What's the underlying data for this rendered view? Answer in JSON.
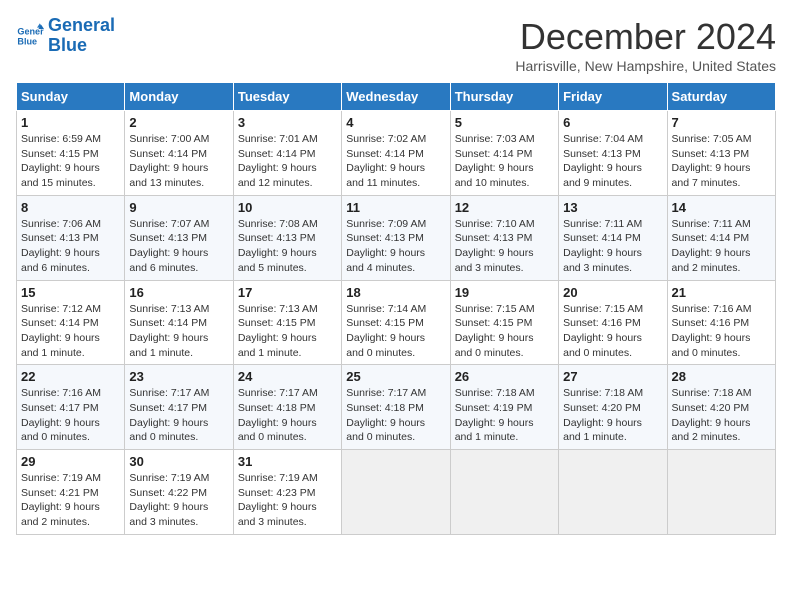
{
  "logo": {
    "line1": "General",
    "line2": "Blue"
  },
  "title": "December 2024",
  "subtitle": "Harrisville, New Hampshire, United States",
  "days_of_week": [
    "Sunday",
    "Monday",
    "Tuesday",
    "Wednesday",
    "Thursday",
    "Friday",
    "Saturday"
  ],
  "weeks": [
    [
      {
        "day": 1,
        "info": "Sunrise: 6:59 AM\nSunset: 4:15 PM\nDaylight: 9 hours\nand 15 minutes."
      },
      {
        "day": 2,
        "info": "Sunrise: 7:00 AM\nSunset: 4:14 PM\nDaylight: 9 hours\nand 13 minutes."
      },
      {
        "day": 3,
        "info": "Sunrise: 7:01 AM\nSunset: 4:14 PM\nDaylight: 9 hours\nand 12 minutes."
      },
      {
        "day": 4,
        "info": "Sunrise: 7:02 AM\nSunset: 4:14 PM\nDaylight: 9 hours\nand 11 minutes."
      },
      {
        "day": 5,
        "info": "Sunrise: 7:03 AM\nSunset: 4:14 PM\nDaylight: 9 hours\nand 10 minutes."
      },
      {
        "day": 6,
        "info": "Sunrise: 7:04 AM\nSunset: 4:13 PM\nDaylight: 9 hours\nand 9 minutes."
      },
      {
        "day": 7,
        "info": "Sunrise: 7:05 AM\nSunset: 4:13 PM\nDaylight: 9 hours\nand 7 minutes."
      }
    ],
    [
      {
        "day": 8,
        "info": "Sunrise: 7:06 AM\nSunset: 4:13 PM\nDaylight: 9 hours\nand 6 minutes."
      },
      {
        "day": 9,
        "info": "Sunrise: 7:07 AM\nSunset: 4:13 PM\nDaylight: 9 hours\nand 6 minutes."
      },
      {
        "day": 10,
        "info": "Sunrise: 7:08 AM\nSunset: 4:13 PM\nDaylight: 9 hours\nand 5 minutes."
      },
      {
        "day": 11,
        "info": "Sunrise: 7:09 AM\nSunset: 4:13 PM\nDaylight: 9 hours\nand 4 minutes."
      },
      {
        "day": 12,
        "info": "Sunrise: 7:10 AM\nSunset: 4:13 PM\nDaylight: 9 hours\nand 3 minutes."
      },
      {
        "day": 13,
        "info": "Sunrise: 7:11 AM\nSunset: 4:14 PM\nDaylight: 9 hours\nand 3 minutes."
      },
      {
        "day": 14,
        "info": "Sunrise: 7:11 AM\nSunset: 4:14 PM\nDaylight: 9 hours\nand 2 minutes."
      }
    ],
    [
      {
        "day": 15,
        "info": "Sunrise: 7:12 AM\nSunset: 4:14 PM\nDaylight: 9 hours\nand 1 minute."
      },
      {
        "day": 16,
        "info": "Sunrise: 7:13 AM\nSunset: 4:14 PM\nDaylight: 9 hours\nand 1 minute."
      },
      {
        "day": 17,
        "info": "Sunrise: 7:13 AM\nSunset: 4:15 PM\nDaylight: 9 hours\nand 1 minute."
      },
      {
        "day": 18,
        "info": "Sunrise: 7:14 AM\nSunset: 4:15 PM\nDaylight: 9 hours\nand 0 minutes."
      },
      {
        "day": 19,
        "info": "Sunrise: 7:15 AM\nSunset: 4:15 PM\nDaylight: 9 hours\nand 0 minutes."
      },
      {
        "day": 20,
        "info": "Sunrise: 7:15 AM\nSunset: 4:16 PM\nDaylight: 9 hours\nand 0 minutes."
      },
      {
        "day": 21,
        "info": "Sunrise: 7:16 AM\nSunset: 4:16 PM\nDaylight: 9 hours\nand 0 minutes."
      }
    ],
    [
      {
        "day": 22,
        "info": "Sunrise: 7:16 AM\nSunset: 4:17 PM\nDaylight: 9 hours\nand 0 minutes."
      },
      {
        "day": 23,
        "info": "Sunrise: 7:17 AM\nSunset: 4:17 PM\nDaylight: 9 hours\nand 0 minutes."
      },
      {
        "day": 24,
        "info": "Sunrise: 7:17 AM\nSunset: 4:18 PM\nDaylight: 9 hours\nand 0 minutes."
      },
      {
        "day": 25,
        "info": "Sunrise: 7:17 AM\nSunset: 4:18 PM\nDaylight: 9 hours\nand 0 minutes."
      },
      {
        "day": 26,
        "info": "Sunrise: 7:18 AM\nSunset: 4:19 PM\nDaylight: 9 hours\nand 1 minute."
      },
      {
        "day": 27,
        "info": "Sunrise: 7:18 AM\nSunset: 4:20 PM\nDaylight: 9 hours\nand 1 minute."
      },
      {
        "day": 28,
        "info": "Sunrise: 7:18 AM\nSunset: 4:20 PM\nDaylight: 9 hours\nand 2 minutes."
      }
    ],
    [
      {
        "day": 29,
        "info": "Sunrise: 7:19 AM\nSunset: 4:21 PM\nDaylight: 9 hours\nand 2 minutes."
      },
      {
        "day": 30,
        "info": "Sunrise: 7:19 AM\nSunset: 4:22 PM\nDaylight: 9 hours\nand 3 minutes."
      },
      {
        "day": 31,
        "info": "Sunrise: 7:19 AM\nSunset: 4:23 PM\nDaylight: 9 hours\nand 3 minutes."
      },
      null,
      null,
      null,
      null
    ]
  ]
}
